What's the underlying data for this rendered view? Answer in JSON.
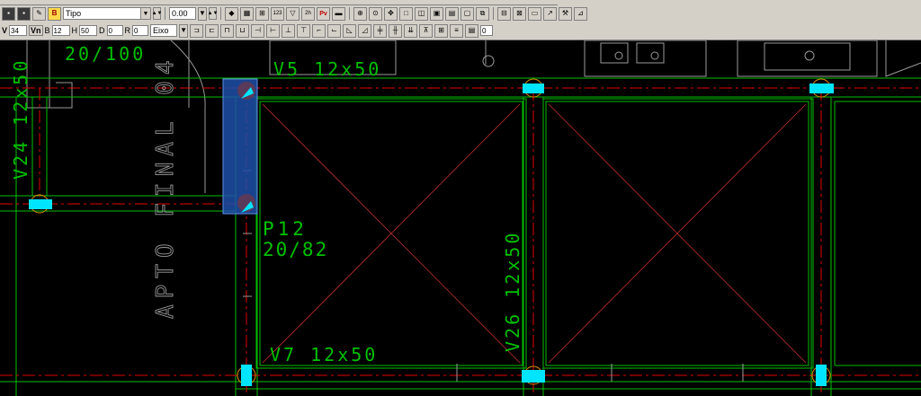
{
  "toolbar": {
    "floor_select": "Tipo",
    "zoom_value": "0.00",
    "field_v_label": "V",
    "field_v_value": "34",
    "field_vn_label": "Vn",
    "field_b_label": "B",
    "field_b_value": "12",
    "field_h_label": "H",
    "field_h_value": "50",
    "field_d_label": "D",
    "field_d_value": "0",
    "field_r_label": "R",
    "field_r_value": "0",
    "axis_select": "Eixo",
    "count_value": "0",
    "text_123": "123",
    "text_2h": "2h",
    "text_pv": "Pv"
  },
  "drawing": {
    "beam_v5": "V5 12x50",
    "beam_v7": "V7 12x50",
    "beam_v24": "V24 12x50",
    "beam_v26": "V26 12x50",
    "pillar_top": "20/100",
    "pillar_p12_name": "P12",
    "pillar_p12_size": "20/82",
    "room_label": "APTO FINAL 04"
  },
  "colors": {
    "background": "#000000",
    "beam_outline": "#00c000",
    "axis_line": "#e00000",
    "diagonal": "#c03030",
    "pillar": "#00e5ff",
    "selection": "#1f4fa8",
    "architecture": "#9a9a9a"
  }
}
